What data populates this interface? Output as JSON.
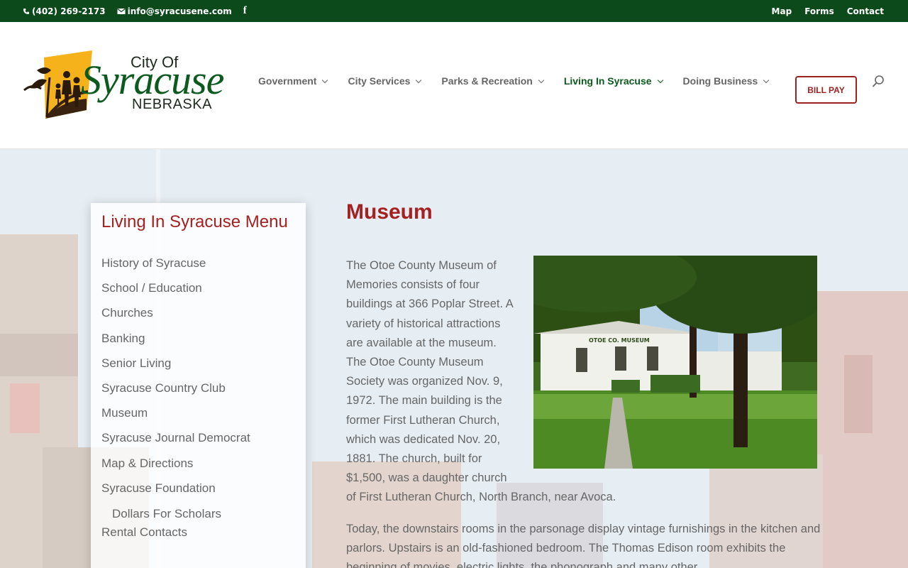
{
  "topbar": {
    "phone": "(402) 269-2173",
    "email": "info@syracusene.com",
    "social_icon": "facebook-icon",
    "links": [
      "Map",
      "Forms",
      "Contact"
    ]
  },
  "logo": {
    "line1": "City Of",
    "line2": "Syracuse",
    "line3": "NEBRASKA"
  },
  "nav": {
    "items": [
      "Government",
      "City Services",
      "Parks & Recreation",
      "Living In Syracuse",
      "Doing Business"
    ],
    "active": "Living In Syracuse",
    "bill_pay": "BILL PAY",
    "search_icon": "search-icon"
  },
  "sidebar": {
    "title": "Living In Syracuse Menu",
    "items": [
      "History of Syracuse",
      "School / Education",
      "Churches",
      "Banking",
      "Senior Living",
      "Syracuse Country Club",
      "Museum",
      "Syracuse Journal Democrat",
      "Map & Directions",
      "Syracuse Foundation",
      "Rental Contacts"
    ],
    "subitem": "Dollars For Scholars"
  },
  "page": {
    "title": "Museum",
    "paragraph1": "The Otoe County Museum of Memories consists of four buildings at 366 Poplar Street. A variety of historical attractions are available at the museum. The Otoe County Museum Society was organized Nov. 9, 1972. The main building is the former First Lutheran Church, which was dedicated Nov. 20, 1881. The church, built for $1,500, was a daughter church of First Lutheran Church, North Branch, near Avoca.",
    "paragraph2": "Today, the downstairs rooms in the parsonage display vintage furnishings in the kitchen and parlors. Upstairs is an old-fashioned bedroom. The Thomas Edison room exhibits the beginning of movies, electric lights, the phonograph and many other",
    "photo_sign": "OTOE CO. MUSEUM"
  },
  "colors": {
    "topbar": "#0c4a1c",
    "brand_green": "#0c5a1d",
    "accent_red": "#a52121",
    "text_gray": "#666666"
  }
}
